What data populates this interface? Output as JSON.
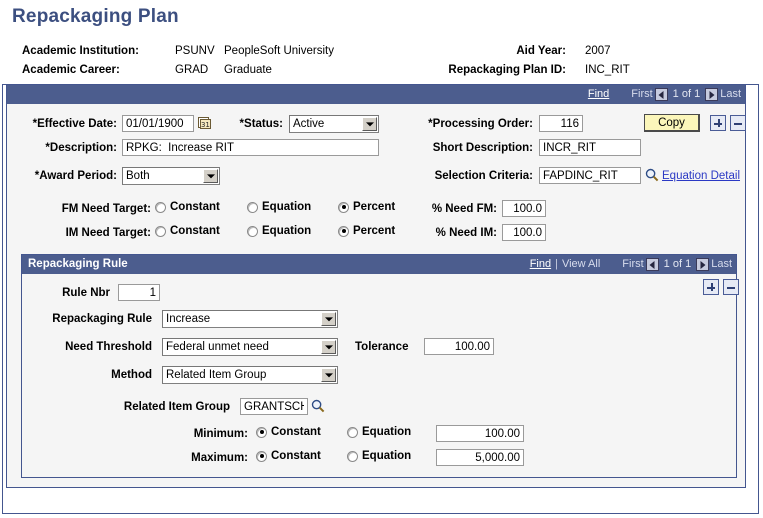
{
  "page": {
    "title": "Repackaging Plan"
  },
  "header": {
    "fields": [
      {
        "label": "Academic Institution:",
        "code": "PSUNV",
        "descr": "PeopleSoft University"
      },
      {
        "label": "Academic Career:",
        "code": "GRAD",
        "descr": "Graduate"
      }
    ],
    "right_fields": [
      {
        "label": "Aid Year:",
        "value": "2007"
      },
      {
        "label": "Repackaging Plan ID:",
        "value": "INC_RIT"
      }
    ]
  },
  "plan_nav": {
    "find": "Find",
    "first": "First",
    "counter": "1 of 1",
    "last": "Last"
  },
  "plan": {
    "effective_date_label": "*Effective Date:",
    "effective_date_value": "01/01/1900",
    "status_label": "*Status:",
    "status_value": "Active",
    "processing_order_label": "*Processing Order:",
    "processing_order_value": "116",
    "copy_button": "Copy",
    "description_label": "*Description:",
    "description_value": "RPKG:  Increase RIT",
    "short_description_label": "Short Description:",
    "short_description_value": "INCR_RIT",
    "award_period_label": "*Award Period:",
    "award_period_value": "Both",
    "selection_criteria_label": "Selection Criteria:",
    "selection_criteria_value": "FAPDINC_RIT",
    "equation_detail_link": "Equation Detail",
    "fm_need_target_label": "FM Need Target:",
    "im_need_target_label": "IM Need Target:",
    "target_options": [
      "Constant",
      "Equation",
      "Percent"
    ],
    "fm_need_target_selected": "Percent",
    "im_need_target_selected": "Percent",
    "pct_need_fm_label": "% Need FM:",
    "pct_need_fm_value": "100.0",
    "pct_need_im_label": "% Need IM:",
    "pct_need_im_value": "100.0"
  },
  "rule_group": {
    "title": "Repackaging Rule",
    "find": "Find",
    "separator": "|",
    "view_all": "View All",
    "first": "First",
    "counter": "1 of 1",
    "last": "Last"
  },
  "rule": {
    "rule_nbr_label": "Rule Nbr",
    "rule_nbr_value": "1",
    "repackaging_rule_label": "Repackaging Rule",
    "repackaging_rule_value": "Increase",
    "need_threshold_label": "Need Threshold",
    "need_threshold_value": "Federal unmet need",
    "tolerance_label": "Tolerance",
    "tolerance_value": "100.00",
    "method_label": "Method",
    "method_value": "Related Item Group",
    "related_item_group_label": "Related Item Group",
    "related_item_group_value": "GRANTSCH",
    "minimum_label": "Minimum:",
    "minimum_mode": "Constant",
    "minimum_value": "100.00",
    "maximum_label": "Maximum:",
    "maximum_mode": "Constant",
    "maximum_value": "5,000.00",
    "mode_options": [
      "Constant",
      "Equation"
    ]
  },
  "colors": {
    "title_blue": "#3c4f80",
    "navbar_blue": "#4c5d8e",
    "panel_bg": "#f5f5f5",
    "link_blue": "#2b39c4",
    "copy_yellow": "#fbf6ba"
  }
}
